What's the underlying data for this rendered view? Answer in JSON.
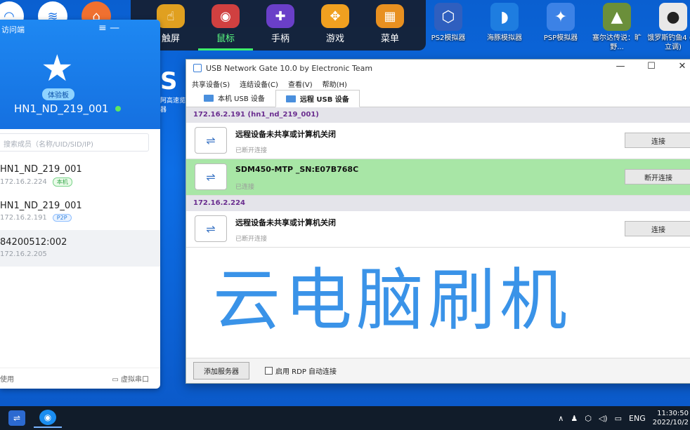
{
  "desktop": {
    "icons": [
      {
        "label": "PS2模拟器",
        "icon": "ps2-icon",
        "color": "#2f5fbf"
      },
      {
        "label": "海豚模拟器",
        "icon": "dolphin-icon",
        "color": "#1e7de0"
      },
      {
        "label": "PSP模拟器",
        "icon": "psp-icon",
        "color": "#3c82e6"
      },
      {
        "label": "塞尔达传说：旷野...",
        "icon": "zelda-icon",
        "color": "#6b8f3a"
      },
      {
        "label": "饿罗斯钓鱼4 (独立调)",
        "icon": "fish-icon",
        "color": "#e8e8e8"
      }
    ],
    "edge_icon_label": "阿高速览器"
  },
  "game_bar": {
    "items": [
      {
        "label": "触屏",
        "icon": "touch-icon",
        "color": "#e0a020"
      },
      {
        "label": "鼠标",
        "icon": "mouse-icon",
        "color": "#d04040",
        "active": true
      },
      {
        "label": "手柄",
        "icon": "gamepad-icon",
        "color": "#6a3fc8"
      },
      {
        "label": "游戏",
        "icon": "game-icon",
        "color": "#f0a020"
      },
      {
        "label": "菜单",
        "icon": "menu-grid-icon",
        "color": "#e89020"
      }
    ]
  },
  "sidebar": {
    "app_title": "访问端",
    "badge": "体验板",
    "device_name": "HN1_ND_219_001",
    "search_placeholder": "搜索成员（名称/UID/SID/IP)",
    "items": [
      {
        "name": "HN1_ND_219_001",
        "ip": "172.16.2.224",
        "tag": "本机",
        "tag_type": "local"
      },
      {
        "name": "HN1_ND_219_001",
        "ip": "172.16.2.191",
        "tag": "P2P",
        "tag_type": "p2p"
      },
      {
        "name": "84200512:002",
        "ip": "172.16.2.205",
        "tag": "",
        "tag_type": ""
      }
    ],
    "footer_left": "使用",
    "footer_right": "虚拟串口"
  },
  "window": {
    "title": "USB Network Gate 10.0 by Electronic Team",
    "menu": [
      "共享设备(S)",
      "连结设备(C)",
      "查看(V)",
      "帮助(H)"
    ],
    "tabs": [
      {
        "label": "本机 USB 设备",
        "active": false
      },
      {
        "label": "远程 USB 设备",
        "active": true
      }
    ],
    "groups": [
      {
        "header": "172.16.2.191  (hn1_nd_219_001)",
        "devices": [
          {
            "name": "远程设备未共享或计算机关闭",
            "status": "已断开连接",
            "action": "连接",
            "connected": false
          },
          {
            "name": "SDM450-MTP _SN:E07B768C",
            "status": "已连接",
            "action": "断开连接",
            "connected": true
          }
        ]
      },
      {
        "header": "172.16.2.224",
        "devices": [
          {
            "name": "远程设备未共享或计算机关闭",
            "status": "已断开连接",
            "action": "连接",
            "connected": false
          }
        ]
      }
    ],
    "footer_button": "添加服务器",
    "footer_checkbox": "启用 RDP 自动连接"
  },
  "watermark": "云电脑刷机",
  "taskbar": {
    "tray_lang": "ENG",
    "time": "11:30:50",
    "date": "2022/10/2"
  }
}
